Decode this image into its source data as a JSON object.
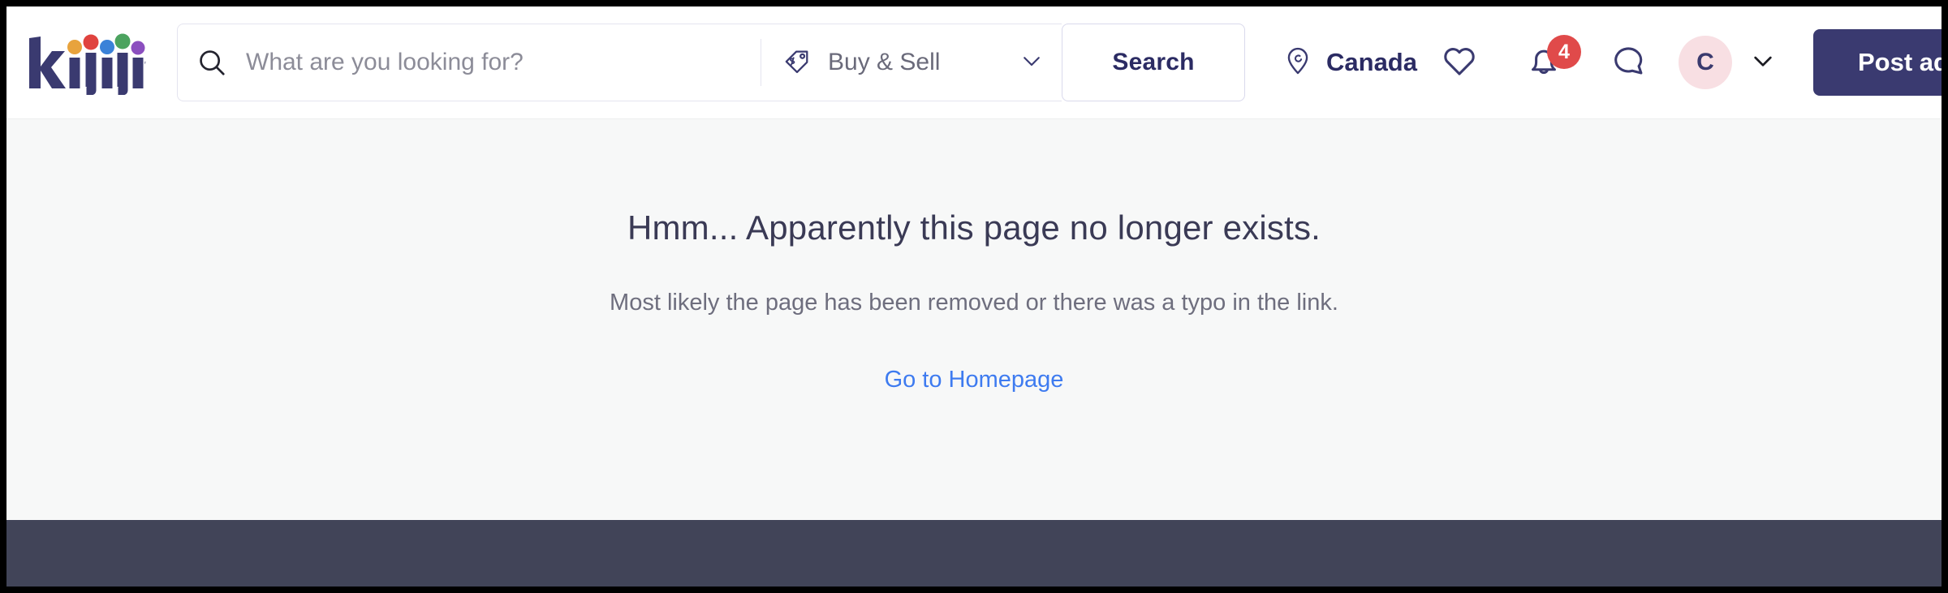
{
  "brand": {
    "name": "kijiji",
    "letters": [
      "k",
      "i",
      "j",
      "i",
      "j",
      "i"
    ],
    "wordmark_color": "#3A3A70",
    "dot_colors": [
      "#E8A33D",
      "#E0433F",
      "#3B82D8",
      "#4CA35F",
      "#8B4FBF"
    ]
  },
  "header": {
    "search": {
      "placeholder": "What are you looking for?",
      "value": "",
      "icon": "search-icon"
    },
    "category": {
      "selected": "Buy & Sell",
      "icon": "price-tag-icon",
      "chevron": "chevron-down-icon"
    },
    "search_button": {
      "label": "Search"
    },
    "location": {
      "label": "Canada",
      "icon": "location-pin-icon"
    },
    "icons": [
      {
        "name": "heart-icon",
        "label": "Favourites",
        "badge": null
      },
      {
        "name": "bell-icon",
        "label": "Notifications",
        "badge": "4"
      },
      {
        "name": "chat-bubble-icon",
        "label": "Messages",
        "badge": null
      }
    ],
    "account": {
      "initial": "C",
      "avatar_bg": "#F8DFE3",
      "chevron": "chevron-down-icon"
    },
    "post_ad": {
      "label": "Post ad",
      "bg": "#3A3A70"
    },
    "badge_color": "#E04A4A"
  },
  "main": {
    "title": "Hmm... Apparently this page no longer exists.",
    "subtitle": "Most likely the page has been removed or there was a typo in the link.",
    "link": "Go to Homepage",
    "link_color": "#3E7BF0",
    "bg": "#F7F8F8"
  },
  "footer": {
    "bg": "#414458"
  }
}
